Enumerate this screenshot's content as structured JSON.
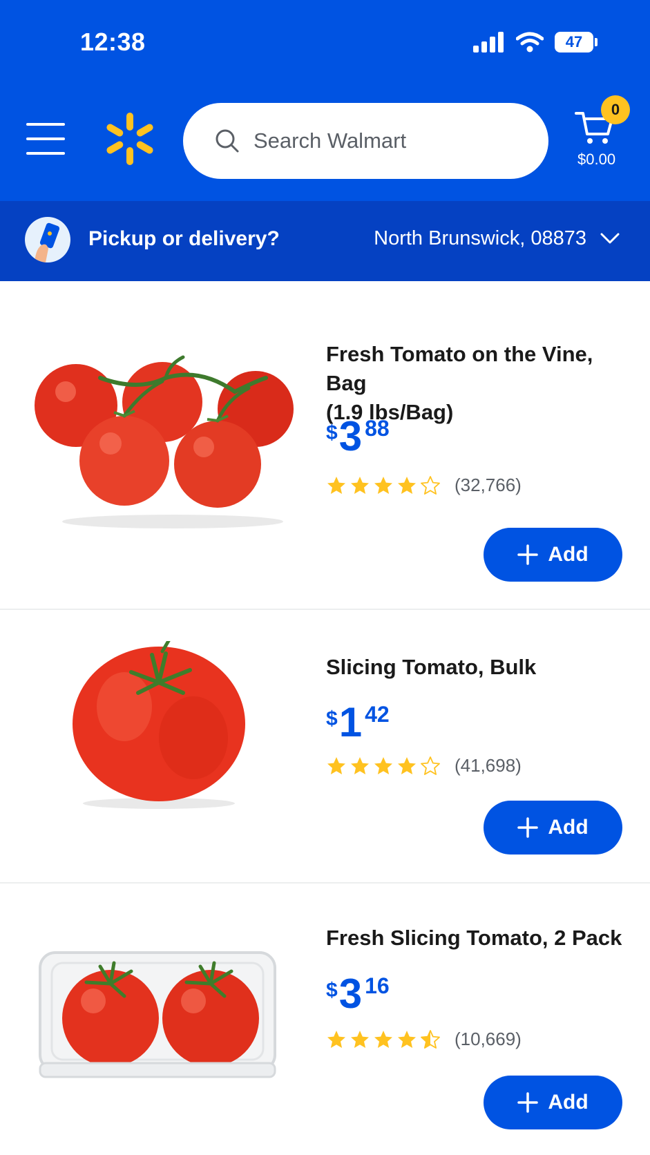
{
  "status": {
    "time": "12:38",
    "battery": "47"
  },
  "header": {
    "search_placeholder": "Search Walmart",
    "cart_count": "0",
    "cart_total": "$0.00"
  },
  "delivery": {
    "label": "Pickup or delivery?",
    "location": "North Brunswick, 08873"
  },
  "colors": {
    "brand_blue": "#0053e2",
    "spark_yellow": "#ffc220",
    "star": "#ffc220"
  },
  "products": [
    {
      "title_line1": "Fresh Tomato on the Vine, Bag",
      "title_line2": "(1.9 lbs/Bag)",
      "price_currency": "$",
      "price_dollars": "3",
      "price_cents": "88",
      "rating": 4,
      "reviews": "(32,766)",
      "add_label": "Add"
    },
    {
      "title_line1": "Slicing Tomato, Bulk",
      "price_currency": "$",
      "price_dollars": "1",
      "price_cents": "42",
      "rating": 4,
      "reviews": "(41,698)",
      "add_label": "Add"
    },
    {
      "title_line1": "Fresh Slicing Tomato, 2 Pack",
      "price_currency": "$",
      "price_dollars": "3",
      "price_cents": "16",
      "rating": 4.5,
      "reviews": "(10,669)",
      "add_label": "Add"
    }
  ]
}
